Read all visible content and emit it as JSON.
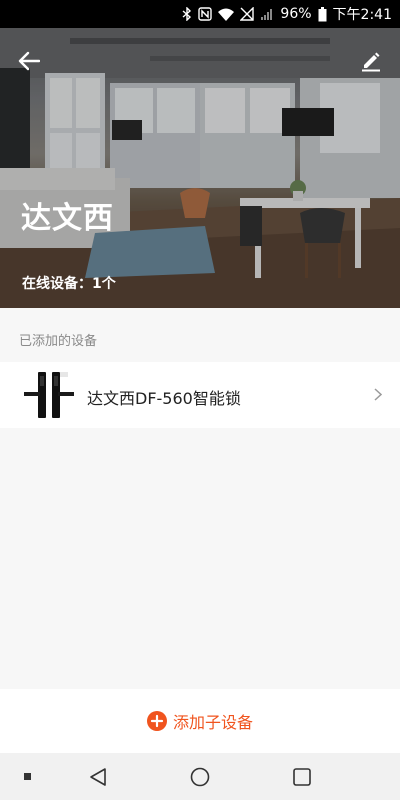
{
  "status_bar": {
    "battery": "96%",
    "time": "下午2:41",
    "icons": [
      "bluetooth-icon",
      "nfc-icon",
      "wifi-icon",
      "signal-off-icon",
      "cell-signal-icon",
      "battery-icon"
    ]
  },
  "header": {
    "back_icon": "arrow-left-icon",
    "edit_icon": "pencil-icon",
    "home_name": "达文西",
    "online_devices": "在线设备：1个"
  },
  "devices_section": {
    "title": "已添加的设备",
    "items": [
      {
        "name": "达文西DF-560智能锁",
        "icon": "smart-lock-icon"
      }
    ]
  },
  "add_bar": {
    "label": "添加子设备",
    "icon": "plus-circle-icon",
    "accent": "#f0541e"
  },
  "nav_bar": {
    "icons": [
      "recent-dot-icon",
      "back-triangle-icon",
      "home-circle-icon",
      "overview-square-icon"
    ]
  }
}
